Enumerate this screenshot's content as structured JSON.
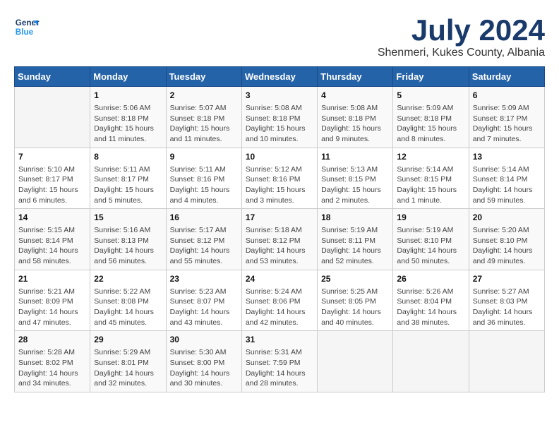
{
  "header": {
    "logo_line1": "General",
    "logo_line2": "Blue",
    "title": "July 2024",
    "subtitle": "Shenmeri, Kukes County, Albania"
  },
  "weekdays": [
    "Sunday",
    "Monday",
    "Tuesday",
    "Wednesday",
    "Thursday",
    "Friday",
    "Saturday"
  ],
  "weeks": [
    [
      {
        "day": null
      },
      {
        "day": "1",
        "sunrise": "Sunrise: 5:06 AM",
        "sunset": "Sunset: 8:18 PM",
        "daylight": "Daylight: 15 hours and 11 minutes."
      },
      {
        "day": "2",
        "sunrise": "Sunrise: 5:07 AM",
        "sunset": "Sunset: 8:18 PM",
        "daylight": "Daylight: 15 hours and 11 minutes."
      },
      {
        "day": "3",
        "sunrise": "Sunrise: 5:08 AM",
        "sunset": "Sunset: 8:18 PM",
        "daylight": "Daylight: 15 hours and 10 minutes."
      },
      {
        "day": "4",
        "sunrise": "Sunrise: 5:08 AM",
        "sunset": "Sunset: 8:18 PM",
        "daylight": "Daylight: 15 hours and 9 minutes."
      },
      {
        "day": "5",
        "sunrise": "Sunrise: 5:09 AM",
        "sunset": "Sunset: 8:18 PM",
        "daylight": "Daylight: 15 hours and 8 minutes."
      },
      {
        "day": "6",
        "sunrise": "Sunrise: 5:09 AM",
        "sunset": "Sunset: 8:17 PM",
        "daylight": "Daylight: 15 hours and 7 minutes."
      }
    ],
    [
      {
        "day": "7",
        "sunrise": "Sunrise: 5:10 AM",
        "sunset": "Sunset: 8:17 PM",
        "daylight": "Daylight: 15 hours and 6 minutes."
      },
      {
        "day": "8",
        "sunrise": "Sunrise: 5:11 AM",
        "sunset": "Sunset: 8:17 PM",
        "daylight": "Daylight: 15 hours and 5 minutes."
      },
      {
        "day": "9",
        "sunrise": "Sunrise: 5:11 AM",
        "sunset": "Sunset: 8:16 PM",
        "daylight": "Daylight: 15 hours and 4 minutes."
      },
      {
        "day": "10",
        "sunrise": "Sunrise: 5:12 AM",
        "sunset": "Sunset: 8:16 PM",
        "daylight": "Daylight: 15 hours and 3 minutes."
      },
      {
        "day": "11",
        "sunrise": "Sunrise: 5:13 AM",
        "sunset": "Sunset: 8:15 PM",
        "daylight": "Daylight: 15 hours and 2 minutes."
      },
      {
        "day": "12",
        "sunrise": "Sunrise: 5:14 AM",
        "sunset": "Sunset: 8:15 PM",
        "daylight": "Daylight: 15 hours and 1 minute."
      },
      {
        "day": "13",
        "sunrise": "Sunrise: 5:14 AM",
        "sunset": "Sunset: 8:14 PM",
        "daylight": "Daylight: 14 hours and 59 minutes."
      }
    ],
    [
      {
        "day": "14",
        "sunrise": "Sunrise: 5:15 AM",
        "sunset": "Sunset: 8:14 PM",
        "daylight": "Daylight: 14 hours and 58 minutes."
      },
      {
        "day": "15",
        "sunrise": "Sunrise: 5:16 AM",
        "sunset": "Sunset: 8:13 PM",
        "daylight": "Daylight: 14 hours and 56 minutes."
      },
      {
        "day": "16",
        "sunrise": "Sunrise: 5:17 AM",
        "sunset": "Sunset: 8:12 PM",
        "daylight": "Daylight: 14 hours and 55 minutes."
      },
      {
        "day": "17",
        "sunrise": "Sunrise: 5:18 AM",
        "sunset": "Sunset: 8:12 PM",
        "daylight": "Daylight: 14 hours and 53 minutes."
      },
      {
        "day": "18",
        "sunrise": "Sunrise: 5:19 AM",
        "sunset": "Sunset: 8:11 PM",
        "daylight": "Daylight: 14 hours and 52 minutes."
      },
      {
        "day": "19",
        "sunrise": "Sunrise: 5:19 AM",
        "sunset": "Sunset: 8:10 PM",
        "daylight": "Daylight: 14 hours and 50 minutes."
      },
      {
        "day": "20",
        "sunrise": "Sunrise: 5:20 AM",
        "sunset": "Sunset: 8:10 PM",
        "daylight": "Daylight: 14 hours and 49 minutes."
      }
    ],
    [
      {
        "day": "21",
        "sunrise": "Sunrise: 5:21 AM",
        "sunset": "Sunset: 8:09 PM",
        "daylight": "Daylight: 14 hours and 47 minutes."
      },
      {
        "day": "22",
        "sunrise": "Sunrise: 5:22 AM",
        "sunset": "Sunset: 8:08 PM",
        "daylight": "Daylight: 14 hours and 45 minutes."
      },
      {
        "day": "23",
        "sunrise": "Sunrise: 5:23 AM",
        "sunset": "Sunset: 8:07 PM",
        "daylight": "Daylight: 14 hours and 43 minutes."
      },
      {
        "day": "24",
        "sunrise": "Sunrise: 5:24 AM",
        "sunset": "Sunset: 8:06 PM",
        "daylight": "Daylight: 14 hours and 42 minutes."
      },
      {
        "day": "25",
        "sunrise": "Sunrise: 5:25 AM",
        "sunset": "Sunset: 8:05 PM",
        "daylight": "Daylight: 14 hours and 40 minutes."
      },
      {
        "day": "26",
        "sunrise": "Sunrise: 5:26 AM",
        "sunset": "Sunset: 8:04 PM",
        "daylight": "Daylight: 14 hours and 38 minutes."
      },
      {
        "day": "27",
        "sunrise": "Sunrise: 5:27 AM",
        "sunset": "Sunset: 8:03 PM",
        "daylight": "Daylight: 14 hours and 36 minutes."
      }
    ],
    [
      {
        "day": "28",
        "sunrise": "Sunrise: 5:28 AM",
        "sunset": "Sunset: 8:02 PM",
        "daylight": "Daylight: 14 hours and 34 minutes."
      },
      {
        "day": "29",
        "sunrise": "Sunrise: 5:29 AM",
        "sunset": "Sunset: 8:01 PM",
        "daylight": "Daylight: 14 hours and 32 minutes."
      },
      {
        "day": "30",
        "sunrise": "Sunrise: 5:30 AM",
        "sunset": "Sunset: 8:00 PM",
        "daylight": "Daylight: 14 hours and 30 minutes."
      },
      {
        "day": "31",
        "sunrise": "Sunrise: 5:31 AM",
        "sunset": "Sunset: 7:59 PM",
        "daylight": "Daylight: 14 hours and 28 minutes."
      },
      {
        "day": null
      },
      {
        "day": null
      },
      {
        "day": null
      }
    ]
  ]
}
